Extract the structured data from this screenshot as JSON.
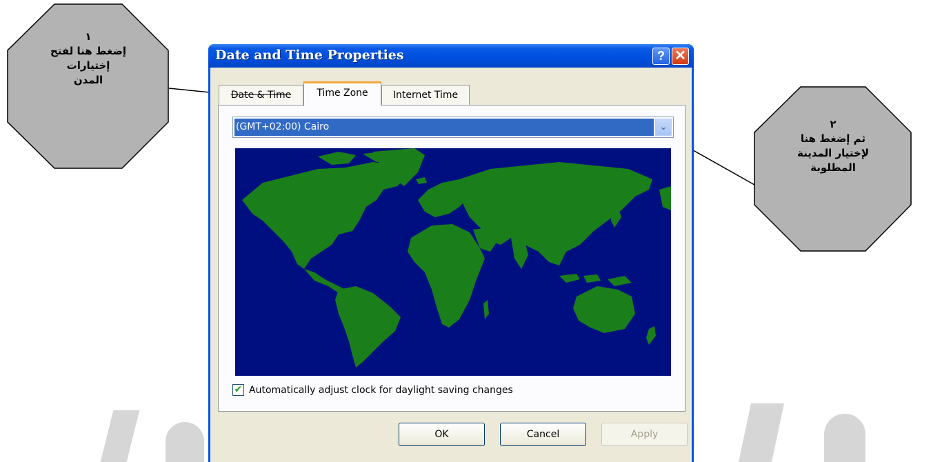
{
  "window": {
    "title": "Date and Time Properties",
    "help_label": "?",
    "close_label": "✕"
  },
  "tabs": [
    {
      "label": "Date & Time"
    },
    {
      "label": "Time Zone"
    },
    {
      "label": "Internet Time"
    }
  ],
  "timezone": {
    "selected": "(GMT+02:00) Cairo",
    "dropdown_icon": "chevron-down-icon"
  },
  "map": {
    "ocean_color": "#000f80",
    "land_color": "#1a7f1a"
  },
  "dst": {
    "checked": true,
    "label": "Automatically adjust clock for daylight saving changes"
  },
  "buttons": {
    "ok": "OK",
    "cancel": "Cancel",
    "apply": "Apply"
  },
  "callouts": [
    {
      "number": "١",
      "lines": [
        "إضغط هنا لفتح",
        "إختيارات",
        "المدن"
      ]
    },
    {
      "number": "٢",
      "lines": [
        "ثم إضغط هنا",
        "لإختيار المدينة",
        "المطلوبة"
      ]
    }
  ],
  "colors": {
    "titlebar": "#0054e3",
    "selection": "#316ac5",
    "callout_fill": "#b3b3b3"
  }
}
